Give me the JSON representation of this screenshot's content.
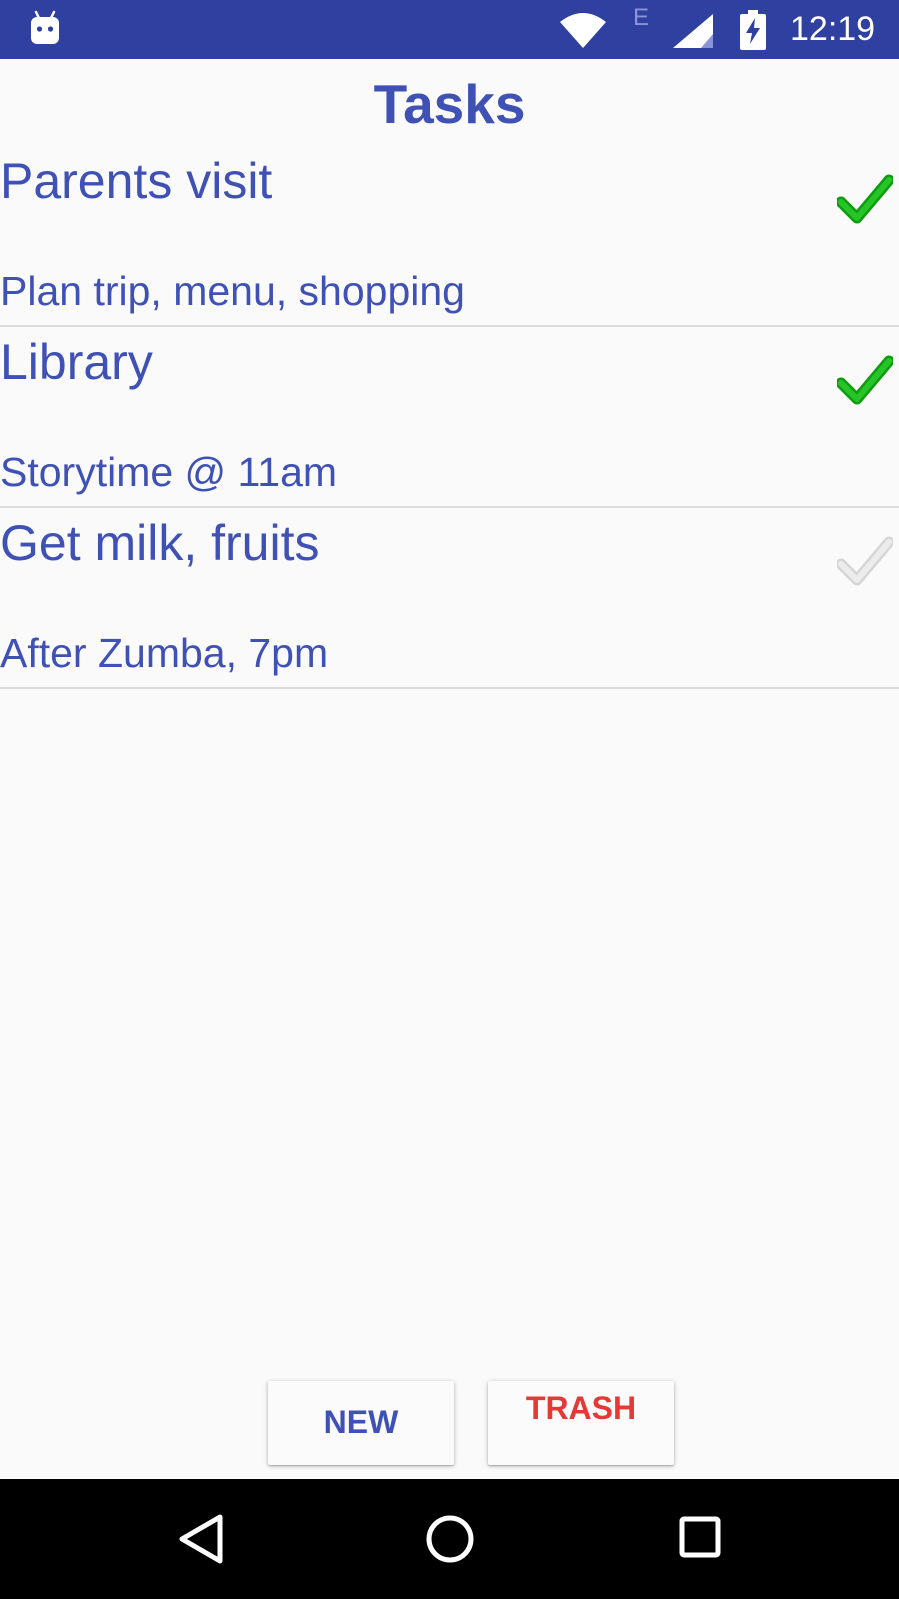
{
  "status_bar": {
    "notification_icon": "android-robot-icon",
    "network_type": "E",
    "time": "12:19",
    "icons": [
      "wifi-icon",
      "cellular-signal-icon",
      "battery-charging-icon"
    ]
  },
  "header": {
    "title": "Tasks"
  },
  "tasks": [
    {
      "title": "Parents visit",
      "note": "Plan trip, menu, shopping",
      "done": true
    },
    {
      "title": "Library",
      "note": "Storytime @ 11am",
      "done": true
    },
    {
      "title": "Get milk, fruits",
      "note": "After Zumba, 7pm",
      "done": false
    }
  ],
  "buttons": {
    "new_label": "NEW",
    "trash_label": "TRASH"
  },
  "nav_bar": {
    "icons": [
      "back-icon",
      "home-icon",
      "recents-icon"
    ]
  },
  "colors": {
    "primary": "#3f51b5",
    "status_bar": "#3040a0",
    "check_done": "#1db71d",
    "check_pending": "#e0e0e0",
    "trash": "#e53935",
    "background": "#fafafa"
  }
}
